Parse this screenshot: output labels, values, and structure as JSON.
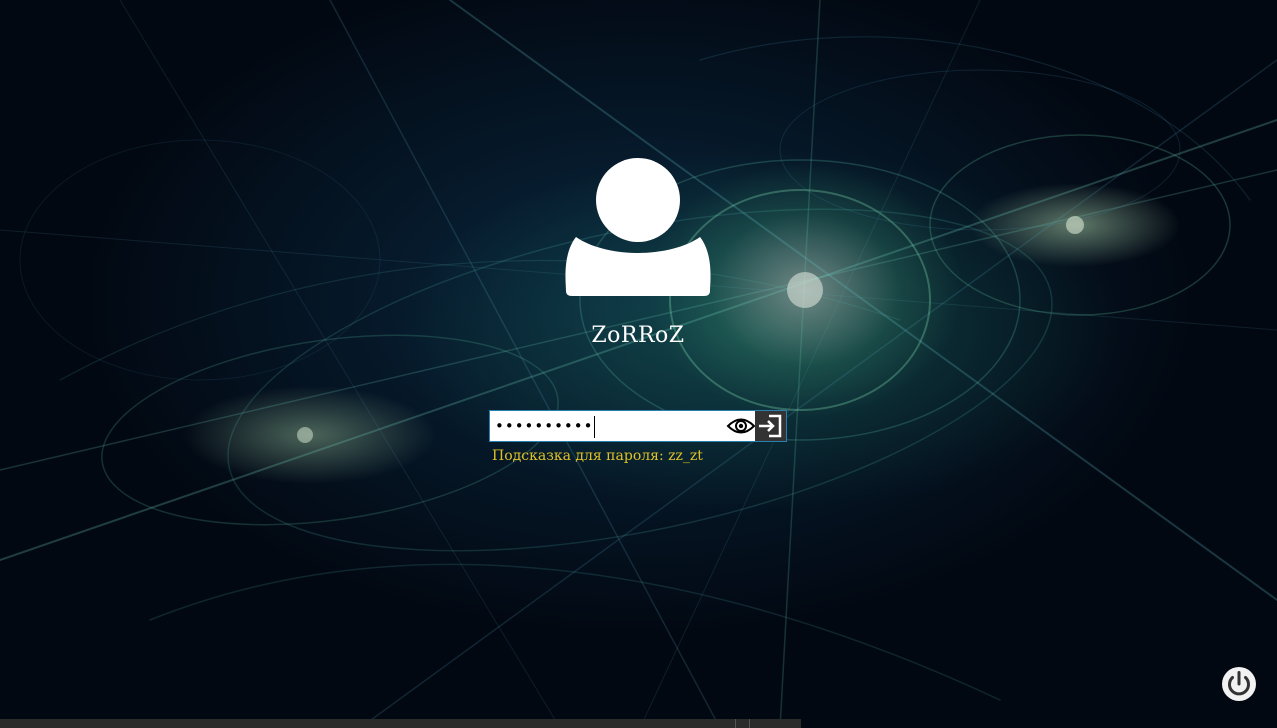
{
  "user": {
    "name": "ZoRRoZ"
  },
  "login": {
    "password_masked": "••••••••••",
    "hint_text": "Подсказка для пароля: zz_zt"
  },
  "icons": {
    "avatar": "user-silhouette-icon",
    "reveal": "eye-icon",
    "submit": "sign-in-arrow-icon",
    "power": "power-icon"
  },
  "colors": {
    "hint": "#e2c228",
    "username": "#ffffff",
    "submit_bg": "#333333",
    "input_border": "#2a7fb0"
  }
}
